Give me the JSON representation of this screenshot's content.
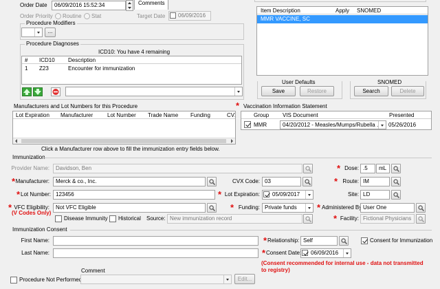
{
  "order": {
    "order_date_label": "Order Date",
    "order_date_value": "06/09/2016 15:52:34",
    "comments_tab": "Comments",
    "order_priority_label": "Order Priority",
    "priority_routine": "Routine",
    "priority_stat": "Stat",
    "target_date_label": "Target Date",
    "target_date_value": "06/09/2016"
  },
  "procedure_modifiers": {
    "title": "Procedure Modifiers",
    "more_button": "..."
  },
  "procedure_diagnoses": {
    "title": "Procedure Diagnoses",
    "icd_remaining": "ICD10: You have 4 remaining",
    "columns": [
      "#",
      "ICD10",
      "Description"
    ],
    "rows": [
      {
        "num": "1",
        "code": "Z23",
        "desc": "Encounter for immunization"
      }
    ]
  },
  "vaccine_search": {
    "columns": [
      "Item Description",
      "Apply",
      "SNOMED"
    ],
    "selected_item": "MMR VACCINE, SC"
  },
  "user_defaults": {
    "title": "User Defaults",
    "save": "Save",
    "restore": "Restore"
  },
  "snomed": {
    "title": "SNOMED",
    "search": "Search",
    "delete": "Delete"
  },
  "manufacturers": {
    "title": "Manufacturers and Lot Numbers for this Procedure",
    "columns": [
      "Lot Expiration",
      "Manufacturer",
      "Lot Number",
      "Trade Name",
      "Funding",
      "CVX"
    ],
    "hint": "Click a Manufacturer row above to fill the immunization entry fields below."
  },
  "vis": {
    "title": "Vaccination Information Statement",
    "columns": [
      "Group",
      "VIS Document",
      "Presented"
    ],
    "row": {
      "group": "MMR",
      "document": "04/20/2012 - Measles/Mumps/Rubella ...",
      "presented": "05/26/2016"
    }
  },
  "immunization": {
    "title": "Immunization",
    "provider_label": "Provider Name:",
    "provider_value": "Davidson, Ben",
    "dose_label": "Dose:",
    "dose_value": ".5",
    "dose_unit": "mL",
    "manufacturer_label": "Manufacturer:",
    "manufacturer_value": "Merck & co., Inc.",
    "cvx_label": "CVX Code:",
    "cvx_value": "03",
    "route_label": "Route:",
    "route_value": "IM",
    "lot_label": "Lot Number:",
    "lot_value": "123456",
    "lot_exp_label": "Lot Expiration:",
    "lot_exp_value": "05/09/2017",
    "site_label": "Site:",
    "site_value": "LD",
    "vfc_label": "VFC Eligibility:",
    "vfc_value": "Not VFC Eligible",
    "funding_label": "Funding:",
    "funding_value": "Private funds",
    "administered_label": "Administered By:",
    "administered_value": "User One",
    "vcodes_note": "(V Codes Only)",
    "disease_immunity": "Disease Immunity",
    "historical": "Historical",
    "source_label": "Source:",
    "source_value": "New immunization record",
    "facility_label": "Facility:",
    "facility_value": "Fictional Physicians"
  },
  "consent": {
    "title": "Immunization Consent",
    "first_name_label": "First Name:",
    "last_name_label": "Last Name:",
    "relationship_label": "Relationship:",
    "relationship_value": "Self",
    "consent_checkbox": "Consent for Immunization",
    "consent_date_label": "Consent Date:",
    "consent_date_value": "06/09/2016",
    "warning_line1": "(Consent recommended for internal use - data not transmitted",
    "warning_line2": "to registry)"
  },
  "bottom": {
    "comment_label": "Comment",
    "not_performed": "Procedure Not Performed",
    "edit_button": "Edit..."
  },
  "colors": {
    "selection": "#3399ff",
    "required": "#e01010"
  }
}
